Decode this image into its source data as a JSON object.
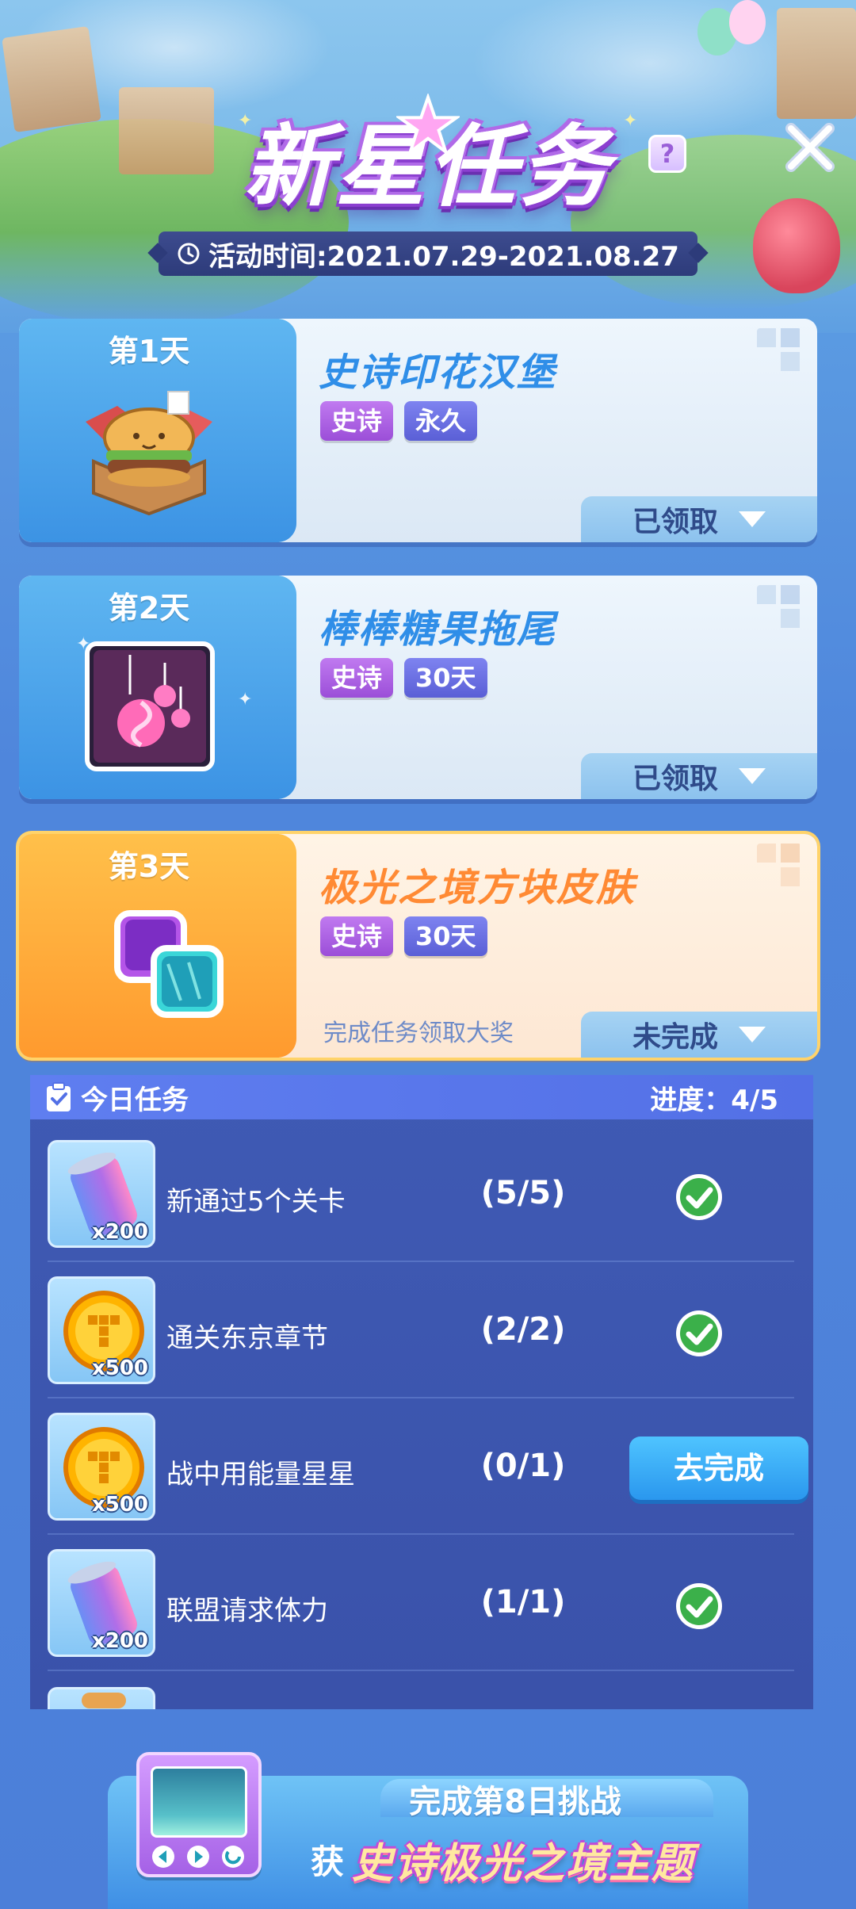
{
  "header": {
    "title": "新星任务",
    "help_label": "?",
    "date_label": "活动时间:2021.07.29-2021.08.27"
  },
  "days": [
    {
      "day": "第1天",
      "reward": "史诗印花汉堡",
      "tags": [
        "史诗",
        "永久"
      ],
      "status": "已领取",
      "hint": ""
    },
    {
      "day": "第2天",
      "reward": "棒棒糖果拖尾",
      "tags": [
        "史诗",
        "30天"
      ],
      "status": "已领取",
      "hint": ""
    },
    {
      "day": "第3天",
      "reward": "极光之境方块皮肤",
      "tags": [
        "史诗",
        "30天"
      ],
      "status": "未完成",
      "hint": "完成任务领取大奖"
    }
  ],
  "tasks": {
    "title": "今日任务",
    "progress_label": "进度：4/5",
    "items": [
      {
        "name": "新通过5个关卡",
        "progress": "(5/5)",
        "qty": "x200",
        "reward_icon": "energy-can-icon",
        "done": true
      },
      {
        "name": "通关东京章节",
        "progress": "(2/2)",
        "qty": "x500",
        "reward_icon": "gold-coin-icon",
        "done": true
      },
      {
        "name": "战中用能量星星",
        "progress": "(0/1)",
        "qty": "x500",
        "reward_icon": "gold-coin-icon",
        "done": false,
        "action": "去完成"
      },
      {
        "name": "联盟请求体力",
        "progress": "(1/1)",
        "qty": "x200",
        "reward_icon": "energy-can-icon",
        "done": true
      }
    ]
  },
  "challenge": {
    "line1": "完成第8日挑战",
    "line2_prefix": "获",
    "line2_highlight": "史诗极光之境主题"
  },
  "colors": {
    "accent_blue": "#2f8ee8",
    "accent_orange": "#ff8a34",
    "epic_purple": "#9b4ed8",
    "success_green": "#3bb04a"
  }
}
